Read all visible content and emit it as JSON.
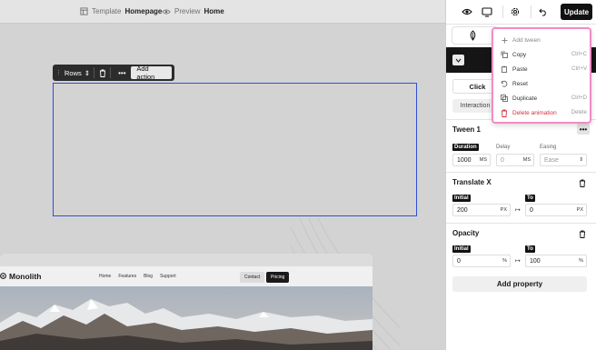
{
  "topbar": {
    "template_prefix": "Template",
    "template_name": "Homepage",
    "preview_prefix": "Preview",
    "preview_name": "Home"
  },
  "toolbar": {
    "layout_label": "Rows",
    "add_action_label": "Add action"
  },
  "site": {
    "logo": "Monolith",
    "nav_links": [
      "Home",
      "Features",
      "Blog",
      "Support"
    ],
    "contact_label": "Contact",
    "pricing_label": "Pricing"
  },
  "panel": {
    "update_label": "Update",
    "trigger_tab": "Click",
    "interaction_tab": "Interaction",
    "tween": {
      "title": "Tween 1",
      "duration_label": "Duration",
      "duration_value": "1000",
      "duration_unit": "MS",
      "delay_label": "Delay",
      "delay_value": "0",
      "delay_unit": "MS",
      "easing_label": "Easing",
      "easing_value": "Ease"
    },
    "translate_x": {
      "title": "Translate X",
      "initial_label": "Initial",
      "initial_value": "200",
      "initial_unit": "PX",
      "to_label": "To",
      "to_value": "0",
      "to_unit": "PX"
    },
    "opacity": {
      "title": "Opacity",
      "initial_label": "Initial",
      "initial_value": "0",
      "initial_unit": "%",
      "to_label": "To",
      "to_value": "100",
      "to_unit": "%"
    },
    "add_property_label": "Add property"
  },
  "context_menu": {
    "items": [
      {
        "label": "Add tween",
        "shortcut": "",
        "icon": "plus-icon"
      },
      {
        "label": "Copy",
        "shortcut": "Ctrl+C",
        "icon": "copy-icon"
      },
      {
        "label": "Paste",
        "shortcut": "Ctrl+V",
        "icon": "paste-icon"
      },
      {
        "label": "Reset",
        "shortcut": "",
        "icon": "reset-icon"
      },
      {
        "label": "Duplicate",
        "shortcut": "Ctrl+D",
        "icon": "duplicate-icon"
      },
      {
        "label": "Delete animation",
        "shortcut": "Delete",
        "icon": "trash-icon"
      }
    ]
  },
  "colors": {
    "selection": "#2f4fd6",
    "menu_border": "#f08cc6",
    "danger": "#d32f3f",
    "update_bg": "#111111"
  }
}
